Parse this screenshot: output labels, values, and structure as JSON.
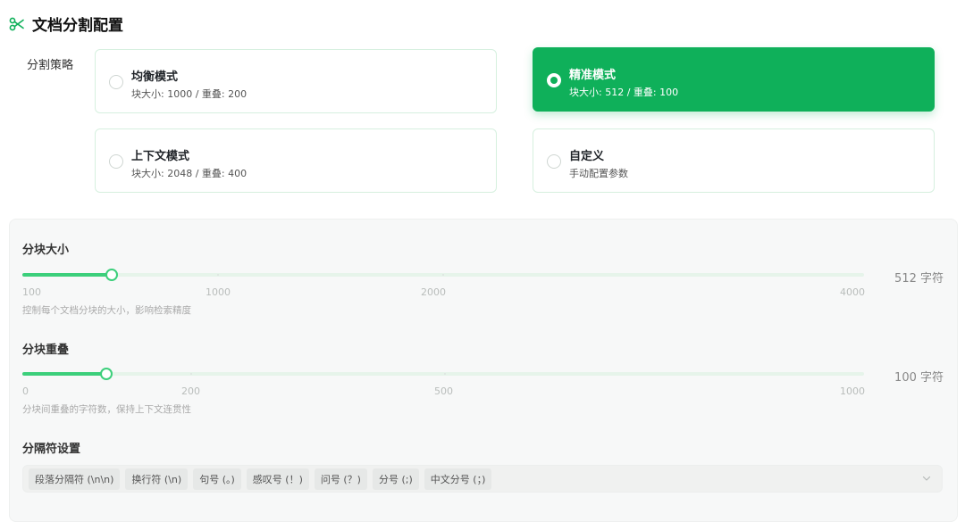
{
  "header": {
    "title": "文档分割配置",
    "icon": "scissors-icon",
    "accent": "#0fb05a"
  },
  "strategy": {
    "label": "分割策略",
    "options": [
      {
        "name": "均衡模式",
        "desc": "块大小: 1000 / 重叠: 200",
        "selected": false
      },
      {
        "name": "精准模式",
        "desc": "块大小: 512 / 重叠: 100",
        "selected": true
      },
      {
        "name": "上下文模式",
        "desc": "块大小: 2048 / 重叠: 400",
        "selected": false
      },
      {
        "name": "自定义",
        "desc": "手动配置参数",
        "selected": false
      }
    ]
  },
  "chunk_size": {
    "title": "分块大小",
    "value": 512,
    "value_label": "512 字符",
    "marks": [
      "100",
      "1000",
      "2000",
      "4000"
    ],
    "hint": "控制每个文档分块的大小，影响检索精度"
  },
  "chunk_overlap": {
    "title": "分块重叠",
    "value": 100,
    "value_label": "100 字符",
    "marks": [
      "0",
      "200",
      "500",
      "1000"
    ],
    "hint": "分块间重叠的字符数，保持上下文连贯性"
  },
  "separators": {
    "title": "分隔符设置",
    "tags": [
      "段落分隔符 (\\n\\n)",
      "换行符 (\\n)",
      "句号 (。)",
      "感叹号 (！)",
      "问号 (？)",
      "分号 (;)",
      "中文分号 (；)"
    ]
  }
}
